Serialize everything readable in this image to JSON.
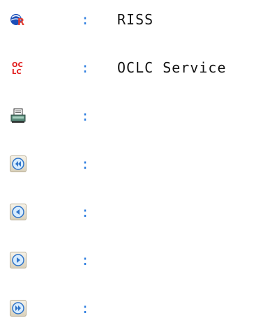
{
  "colors": {
    "colon": "#2f7fe0",
    "label": "#111111",
    "button_circle": "#66a9ea",
    "oclc_red": "#e21e1e",
    "riss_blue": "#1c4fb8",
    "riss_red": "#e33b2f"
  },
  "legend": {
    "rows": [
      {
        "icon": "riss-logo-icon",
        "separator": ":",
        "label": "RISS"
      },
      {
        "icon": "oclc-logo-icon",
        "separator": ":",
        "label": "OCLC Service"
      },
      {
        "icon": "printer-icon",
        "separator": ":",
        "label": ""
      },
      {
        "icon": "first-page-icon",
        "separator": ":",
        "label": ""
      },
      {
        "icon": "previous-page-icon",
        "separator": ":",
        "label": ""
      },
      {
        "icon": "next-page-icon",
        "separator": ":",
        "label": ""
      },
      {
        "icon": "last-page-icon",
        "separator": ":",
        "label": ""
      }
    ]
  }
}
